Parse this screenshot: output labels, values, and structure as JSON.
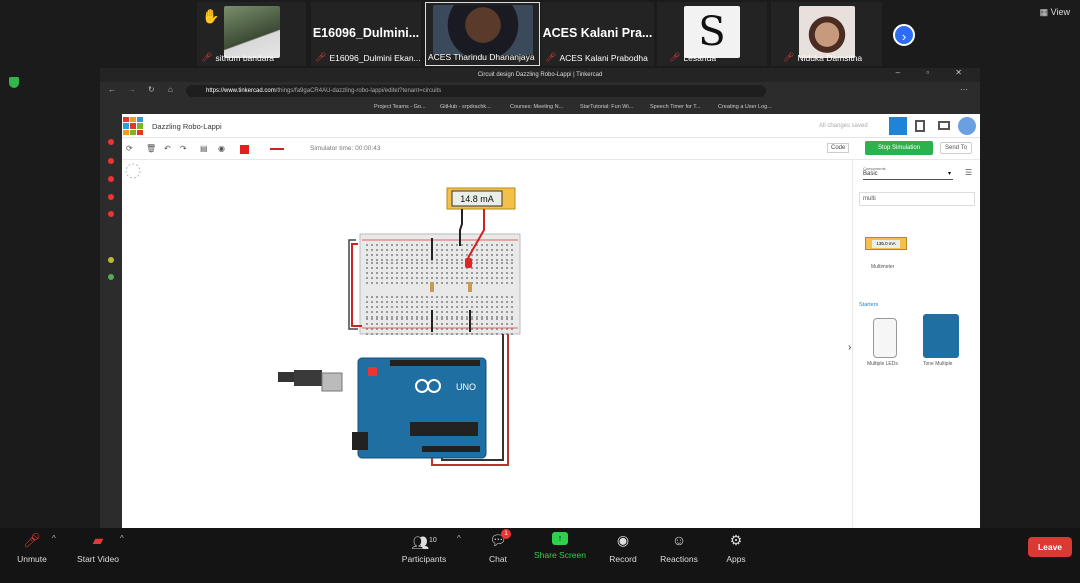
{
  "meeting": {
    "view_label": "View",
    "participants": [
      {
        "name": "sithum bandara",
        "type": "photo"
      },
      {
        "name": "E16096_Dulmini Ekan...",
        "big": "E16096_Dulmini...",
        "type": "name"
      },
      {
        "name": "ACES Tharindu Dhananjaya",
        "type": "photo"
      },
      {
        "name": "ACES Kalani Prabodha",
        "big": "ACES Kalani Pra...",
        "type": "name"
      },
      {
        "name": "Lesanda",
        "type": "photo"
      },
      {
        "name": "Niduka Damsitha",
        "type": "photo"
      }
    ]
  },
  "browser": {
    "title": "Circuit design Dazzling Robo-Lappi | Tinkercad",
    "url_host": "https://www.tinkercad.com",
    "url_path": "/things/fa9gaCR4AU-dazzling-robo-lappi/editel?tenant=circuits",
    "bookmarks": [
      "Project Teams - Go...",
      "GitHub - srpdrachk...",
      "Courses: Meeting N...",
      "StarTutorial: Fun Wi...",
      "Speech Timer for T...",
      "Creating a User Log..."
    ]
  },
  "tinkercad": {
    "design_title": "Dazzling Robo-Lappi",
    "saved_status": "All changes saved",
    "simulator_time": "Simulator time: 00:00:43",
    "code_label": "Code",
    "stop_label": "Stop Simulation",
    "send_label": "Send To",
    "multimeter_reading": "14.8 mA",
    "panel": {
      "components_label": "Components",
      "components_value": "Basic",
      "search_value": "multi",
      "multimeter_preview": "135.0 mA",
      "multimeter_label": "Multimeter",
      "starters_label": "Starters",
      "starter_1": "Multiple LEDs",
      "starter_2": "Tone Multiple"
    },
    "arduino_label": "UNO"
  },
  "toolbar": {
    "unmute": "Unmute",
    "start_video": "Start Video",
    "participants": "Participants",
    "participants_count": "10",
    "chat": "Chat",
    "chat_badge": "1",
    "share_screen": "Share Screen",
    "record": "Record",
    "reactions": "Reactions",
    "apps": "Apps",
    "leave": "Leave"
  }
}
